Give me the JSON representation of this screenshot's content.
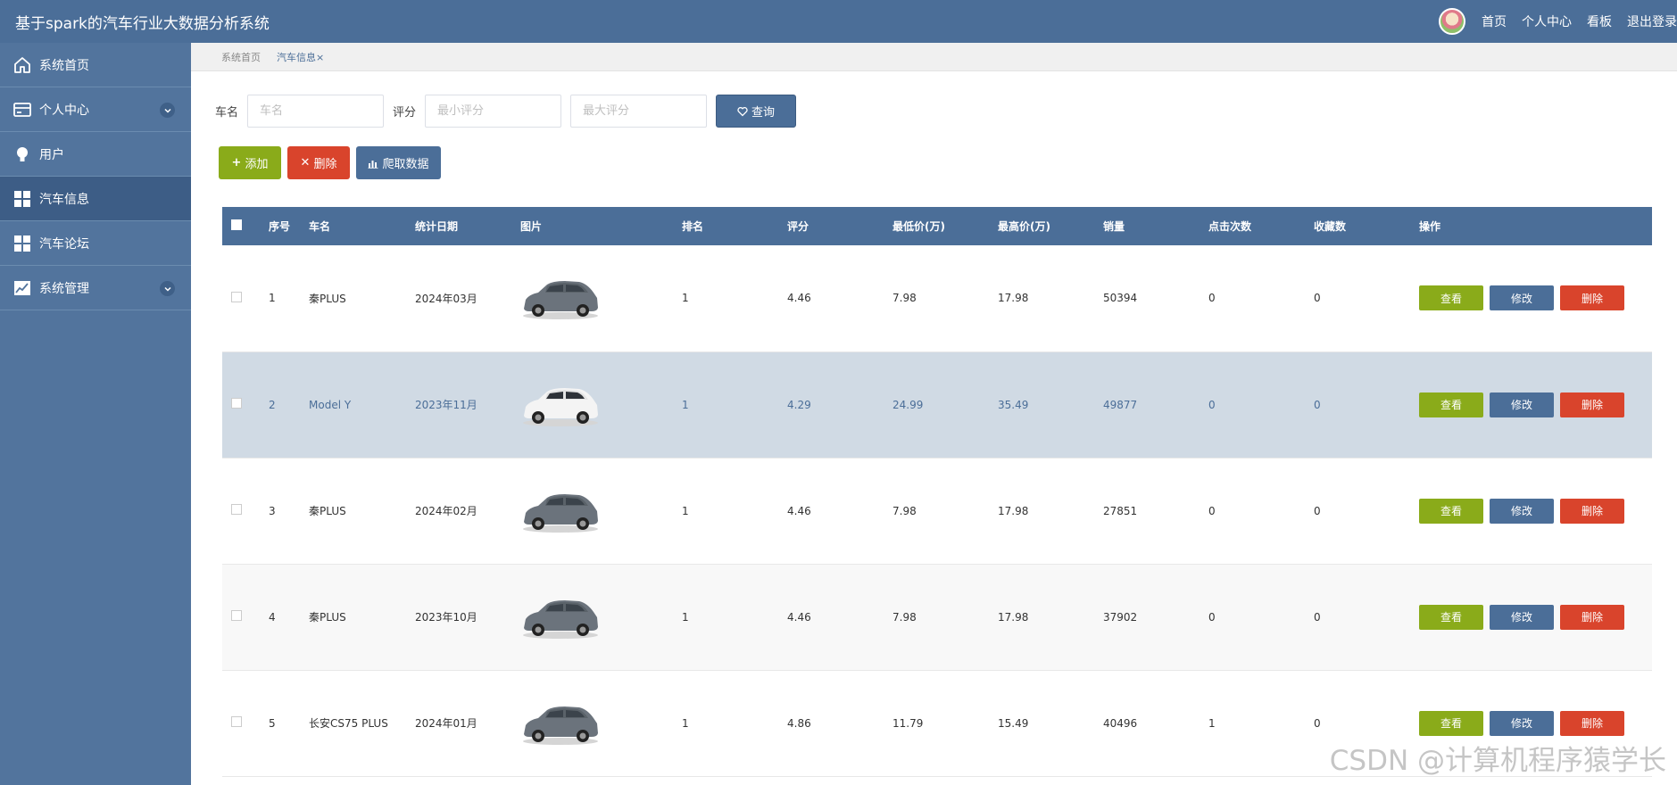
{
  "header": {
    "title": "基于spark的汽车行业大数据分析系统",
    "links": [
      "首页",
      "个人中心",
      "看板",
      "退出登录"
    ]
  },
  "sidebar": {
    "items": [
      {
        "label": "系统首页",
        "icon": "home-icon",
        "expandable": false,
        "active": false
      },
      {
        "label": "个人中心",
        "icon": "card-icon",
        "expandable": true,
        "active": false
      },
      {
        "label": "用户",
        "icon": "bulb-icon",
        "expandable": false,
        "active": false
      },
      {
        "label": "汽车信息",
        "icon": "grid-icon",
        "expandable": false,
        "active": true
      },
      {
        "label": "汽车论坛",
        "icon": "grid-icon",
        "expandable": false,
        "active": false
      },
      {
        "label": "系统管理",
        "icon": "chart-icon",
        "expandable": true,
        "active": false
      }
    ]
  },
  "breadcrumb": {
    "home": "系统首页",
    "current": "汽车信息",
    "close": "×"
  },
  "search": {
    "car_name_label": "车名",
    "car_name_placeholder": "车名",
    "car_name_value": "",
    "rating_label": "评分",
    "min_rating_placeholder": "最小评分",
    "max_rating_placeholder": "最大评分",
    "search_button": "查询"
  },
  "actions": {
    "add": "添加",
    "delete": "删除",
    "crawl": "爬取数据"
  },
  "table": {
    "columns": [
      "序号",
      "车名",
      "统计日期",
      "图片",
      "排名",
      "评分",
      "最低价(万)",
      "最高价(万)",
      "销量",
      "点击次数",
      "收藏数",
      "操作"
    ],
    "op_labels": {
      "view": "查看",
      "edit": "修改",
      "delete": "删除"
    },
    "rows": [
      {
        "index": "1",
        "name": "秦PLUS",
        "date": "2024年03月",
        "image": "gray-suv",
        "rank": "1",
        "rating": "4.46",
        "min_price": "7.98",
        "max_price": "17.98",
        "sales": "50394",
        "clicks": "0",
        "favorites": "0"
      },
      {
        "index": "2",
        "name": "Model Y",
        "date": "2023年11月",
        "image": "white-suv",
        "rank": "1",
        "rating": "4.29",
        "min_price": "24.99",
        "max_price": "35.49",
        "sales": "49877",
        "clicks": "0",
        "favorites": "0"
      },
      {
        "index": "3",
        "name": "秦PLUS",
        "date": "2024年02月",
        "image": "gray-suv",
        "rank": "1",
        "rating": "4.46",
        "min_price": "7.98",
        "max_price": "17.98",
        "sales": "27851",
        "clicks": "0",
        "favorites": "0"
      },
      {
        "index": "4",
        "name": "秦PLUS",
        "date": "2023年10月",
        "image": "gray-suv",
        "rank": "1",
        "rating": "4.46",
        "min_price": "7.98",
        "max_price": "17.98",
        "sales": "37902",
        "clicks": "0",
        "favorites": "0"
      },
      {
        "index": "5",
        "name": "长安CS75 PLUS",
        "date": "2024年01月",
        "image": "gray-suv",
        "rank": "1",
        "rating": "4.86",
        "min_price": "11.79",
        "max_price": "15.49",
        "sales": "40496",
        "clicks": "1",
        "favorites": "0"
      }
    ]
  },
  "watermark": "CSDN @计算机程序猿学长",
  "colors": {
    "primary": "#4b6e98",
    "sidebar": "#52749d",
    "sidebar_active": "#3d5d86",
    "success": "#8aab1a",
    "danger": "#d9442c",
    "row_highlight": "#d0dae4"
  }
}
